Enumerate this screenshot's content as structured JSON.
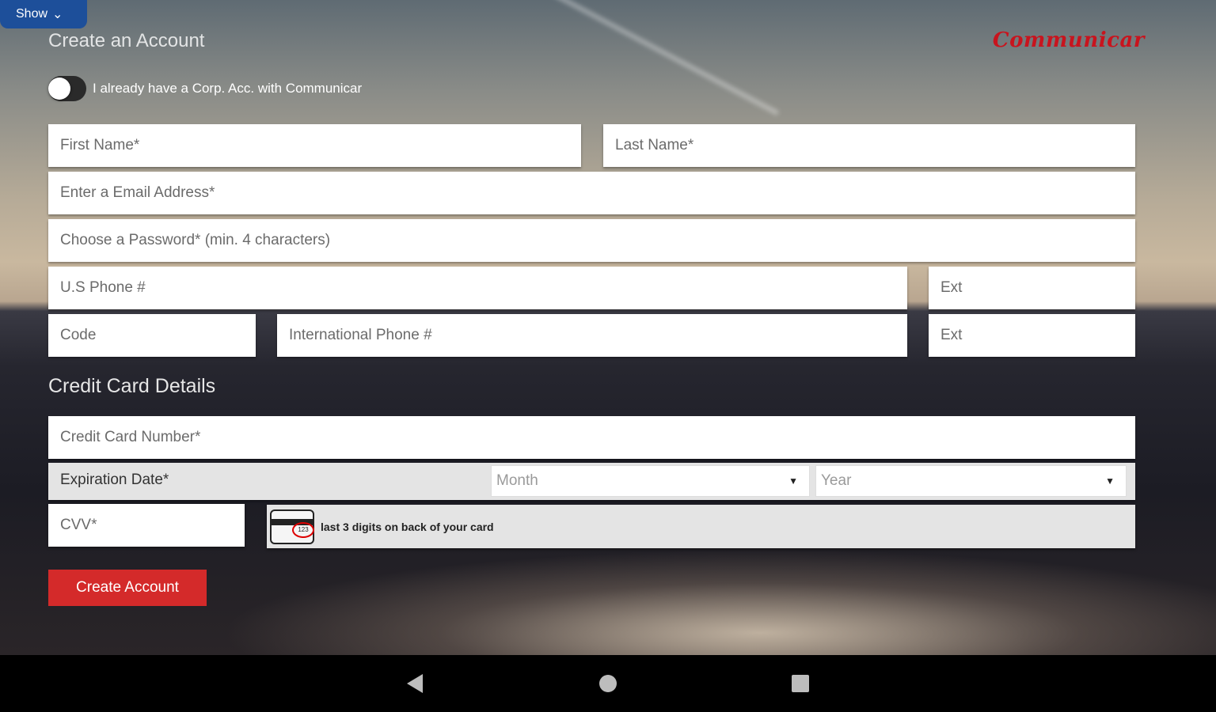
{
  "show_button": {
    "label": "Show",
    "icon": "chevron-down-icon"
  },
  "header": {
    "title": "Create an Account",
    "brand": "Communicar"
  },
  "corp_toggle": {
    "label": "I already have a Corp. Acc. with Communicar",
    "on": false
  },
  "fields": {
    "first_name": "First Name*",
    "last_name": "Last Name*",
    "email": "Enter a Email Address*",
    "password": "Choose a Password* (min. 4 characters)",
    "us_phone": "U.S Phone #",
    "us_ext": "Ext",
    "intl_code": "Code",
    "intl_phone": "International Phone #",
    "intl_ext": "Ext"
  },
  "credit_card": {
    "section_title": "Credit Card Details",
    "number": "Credit Card Number*",
    "expiration_label": "Expiration Date*",
    "month": "Month",
    "year": "Year",
    "cvv": "CVV*",
    "cvv_hint": "last 3 digits on back of your card",
    "card_icon_digits": "123"
  },
  "submit": {
    "label": "Create Account",
    "color": "#d42a2a"
  },
  "system_nav": {
    "back": "back-icon",
    "home": "home-icon",
    "recents": "recents-icon"
  }
}
